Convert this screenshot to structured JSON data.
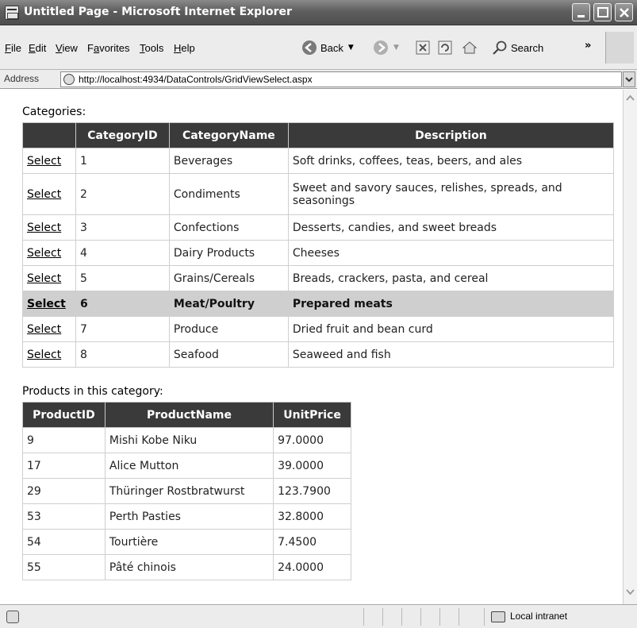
{
  "window": {
    "title": "Untitled Page - Microsoft Internet Explorer"
  },
  "menu": {
    "items": [
      "File",
      "Edit",
      "View",
      "Favorites",
      "Tools",
      "Help"
    ],
    "mnemonics": [
      "F",
      "E",
      "V",
      "a",
      "T",
      "H"
    ]
  },
  "toolbar": {
    "back_label": "Back",
    "search_label": "Search",
    "icons": [
      "back-arrow-icon",
      "forward-arrow-icon",
      "stop-icon",
      "refresh-icon",
      "home-icon",
      "search-icon"
    ]
  },
  "address": {
    "label": "Address",
    "url": "http://localhost:4934/DataControls/GridViewSelect.aspx"
  },
  "categories": {
    "label": "Categories:",
    "headers": [
      "",
      "CategoryID",
      "CategoryName",
      "Description"
    ],
    "select_text": "Select",
    "selected_index": 5,
    "rows": [
      {
        "id": "1",
        "name": "Beverages",
        "description": "Soft drinks, coffees, teas, beers, and ales"
      },
      {
        "id": "2",
        "name": "Condiments",
        "description": "Sweet and savory sauces, relishes, spreads, and seasonings"
      },
      {
        "id": "3",
        "name": "Confections",
        "description": "Desserts, candies, and sweet breads"
      },
      {
        "id": "4",
        "name": "Dairy Products",
        "description": "Cheeses"
      },
      {
        "id": "5",
        "name": "Grains/Cereals",
        "description": "Breads, crackers, pasta, and cereal"
      },
      {
        "id": "6",
        "name": "Meat/Poultry",
        "description": "Prepared meats"
      },
      {
        "id": "7",
        "name": "Produce",
        "description": "Dried fruit and bean curd"
      },
      {
        "id": "8",
        "name": "Seafood",
        "description": "Seaweed and fish"
      }
    ]
  },
  "products": {
    "label": "Products in this category:",
    "headers": [
      "ProductID",
      "ProductName",
      "UnitPrice"
    ],
    "rows": [
      {
        "id": "9",
        "name": "Mishi Kobe Niku",
        "price": "97.0000"
      },
      {
        "id": "17",
        "name": "Alice Mutton",
        "price": "39.0000"
      },
      {
        "id": "29",
        "name": "Thüringer Rostbratwurst",
        "price": "123.7900"
      },
      {
        "id": "53",
        "name": "Perth Pasties",
        "price": "32.8000"
      },
      {
        "id": "54",
        "name": "Tourtière",
        "price": "7.4500"
      },
      {
        "id": "55",
        "name": "Pâté chinois",
        "price": "24.0000"
      }
    ]
  },
  "status": {
    "zone": "Local intranet"
  },
  "colors": {
    "header_bg": "#3a3a3a",
    "selected_row_bg": "#cfcfcf"
  }
}
